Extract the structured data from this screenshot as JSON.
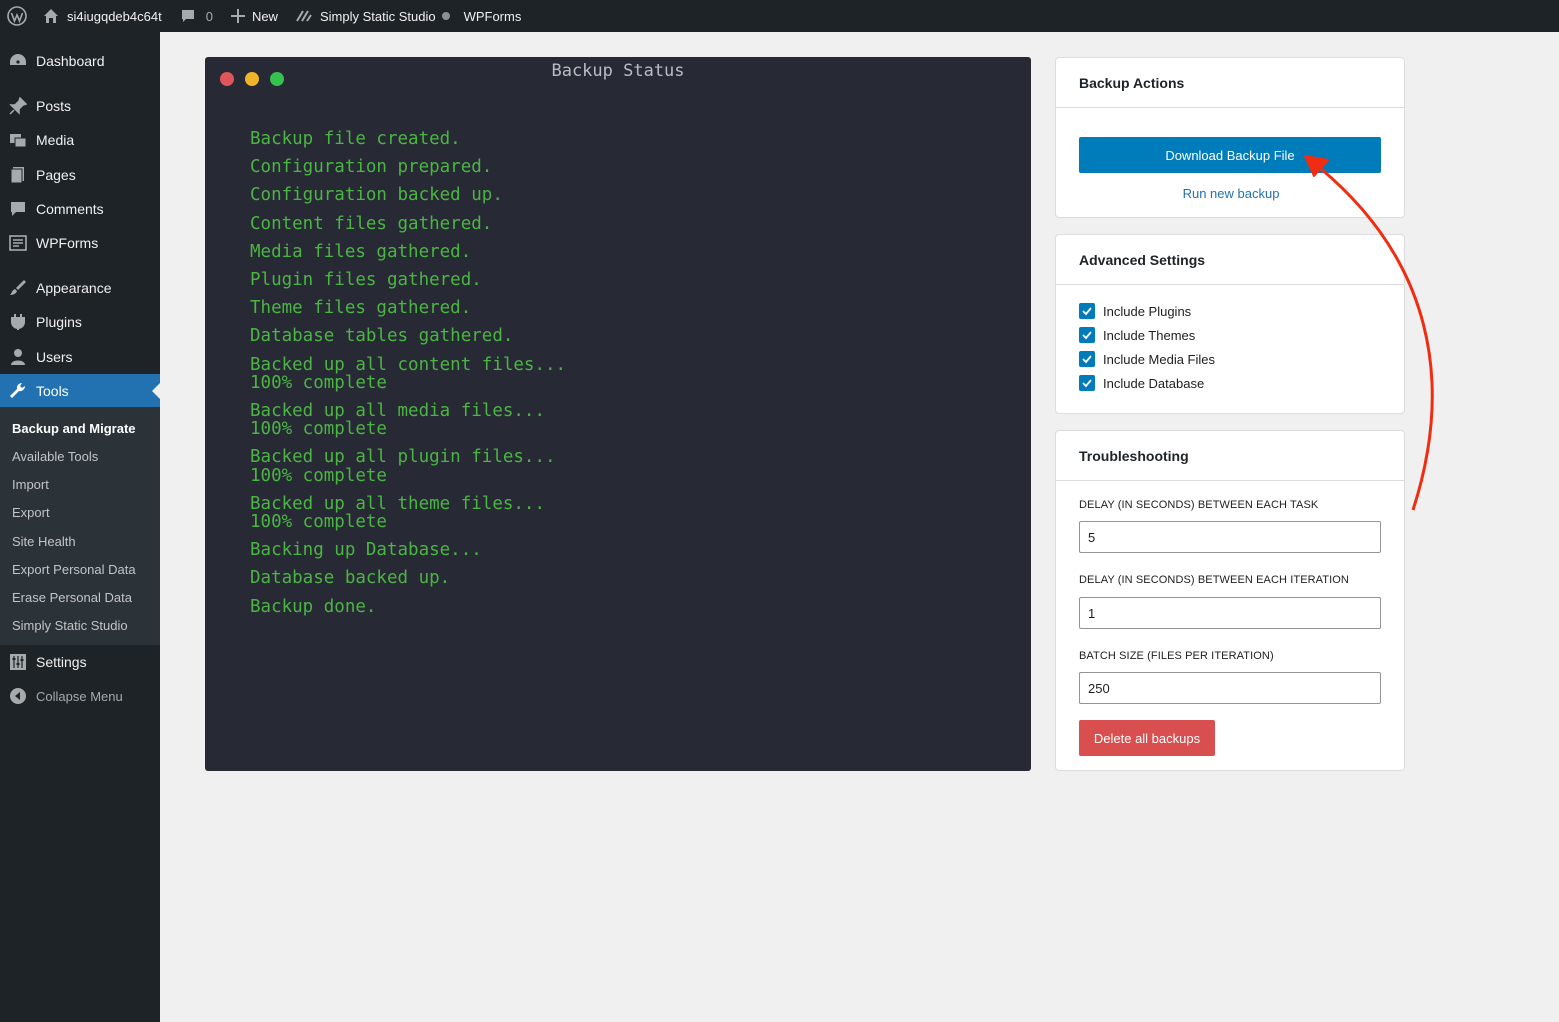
{
  "adminbar": {
    "site_name": "si4iugqdeb4c64t",
    "comments_count": "0",
    "new_label": "New",
    "plugin_label": "Simply Static Studio",
    "wpforms_label": "WPForms"
  },
  "sidebar": {
    "items": [
      {
        "label": "Dashboard",
        "icon": "dashboard-icon"
      },
      {
        "label": "Posts",
        "icon": "pin-icon"
      },
      {
        "label": "Media",
        "icon": "media-icon"
      },
      {
        "label": "Pages",
        "icon": "pages-icon"
      },
      {
        "label": "Comments",
        "icon": "comment-icon"
      },
      {
        "label": "WPForms",
        "icon": "form-icon"
      },
      {
        "label": "Appearance",
        "icon": "brush-icon"
      },
      {
        "label": "Plugins",
        "icon": "plug-icon"
      },
      {
        "label": "Users",
        "icon": "user-icon"
      },
      {
        "label": "Tools",
        "icon": "wrench-icon"
      },
      {
        "label": "Settings",
        "icon": "sliders-icon"
      }
    ],
    "submenu": [
      "Backup and Migrate",
      "Available Tools",
      "Import",
      "Export",
      "Site Health",
      "Export Personal Data",
      "Erase Personal Data",
      "Simply Static Studio"
    ],
    "collapse_label": "Collapse Menu"
  },
  "terminal": {
    "title": "Backup Status",
    "lines": [
      "Backup file created.",
      "Configuration prepared.",
      "Configuration backed up.",
      "Content files gathered.",
      "Media files gathered.",
      "Plugin files gathered.",
      "Theme files gathered.",
      "Database tables gathered.",
      "Backed up all content files...",
      "100% complete",
      "Backed up all media files...",
      "100% complete",
      "Backed up all plugin files...",
      "100% complete",
      "Backed up all theme files...",
      "100% complete",
      "Backing up Database...",
      "Database backed up.",
      "Backup done."
    ],
    "colors": {
      "background": "#272a34",
      "text": "#4bb543",
      "red": "#e0555b",
      "yellow": "#f0b429",
      "green": "#35c24f"
    }
  },
  "backup_actions": {
    "title": "Backup Actions",
    "download_label": "Download Backup File",
    "run_new_label": "Run new backup"
  },
  "advanced_settings": {
    "title": "Advanced Settings",
    "options": [
      {
        "label": "Include Plugins",
        "checked": true
      },
      {
        "label": "Include Themes",
        "checked": true
      },
      {
        "label": "Include Media Files",
        "checked": true
      },
      {
        "label": "Include Database",
        "checked": true
      }
    ]
  },
  "troubleshooting": {
    "title": "Troubleshooting",
    "fields": [
      {
        "label": "DELAY (IN SECONDS) BETWEEN EACH TASK",
        "value": "5"
      },
      {
        "label": "DELAY (IN SECONDS) BETWEEN EACH ITERATION",
        "value": "1"
      },
      {
        "label": "BATCH SIZE (FILES PER ITERATION)",
        "value": "250"
      }
    ],
    "delete_label": "Delete all backups"
  },
  "annotation": {
    "color": "#f02d12"
  }
}
